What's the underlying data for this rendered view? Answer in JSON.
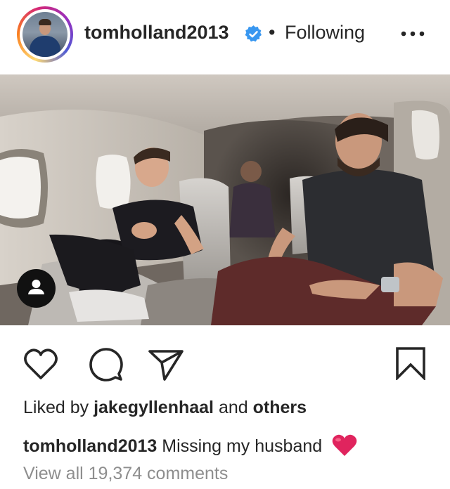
{
  "post": {
    "username": "tomholland2013",
    "verified_icon": "verified-badge-icon",
    "separator": "•",
    "follow_status": "Following",
    "more_icon": "more-horizontal-icon",
    "media_alt": "Photo of two smiling men seated in a private jet cabin",
    "likes_prefix": "Liked by",
    "liked_by_user": "jakegyllenhaal",
    "likes_and": "and",
    "likes_others": "others",
    "caption_user": "tomholland2013",
    "caption_text": "Missing my husband",
    "caption_emoji": "red-heart-emoji",
    "view_comments": "View all 19,374 comments"
  },
  "colors": {
    "text": "#262626",
    "muted": "#8e8e8e",
    "verified": "#3897f0",
    "heart": "#e0245e"
  }
}
